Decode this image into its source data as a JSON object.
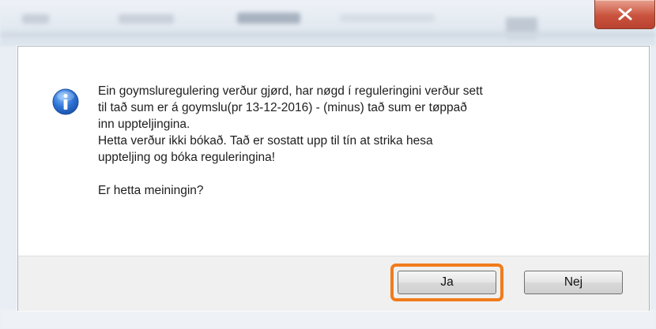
{
  "window": {
    "close_symbol": "X"
  },
  "dialog": {
    "icon": "info-icon",
    "message_lines": [
      "Ein goymsluregulering verður gjørd, har nøgd í reguleringini verður sett",
      "til tað sum er á goymslu(pr 13-12-2016) - (minus) tað sum er tøppað",
      "inn uppteljingina.",
      "Hetta verður ikki bókað. Tað er sostatt upp til tín at strika hesa",
      "uppteljing og bóka reguleringina!"
    ],
    "question": "Er hetta meiningin?",
    "buttons": {
      "yes_label": "Ja",
      "no_label": "Nej"
    },
    "highlighted_button": "yes",
    "highlight_color": "#f07c1c"
  }
}
